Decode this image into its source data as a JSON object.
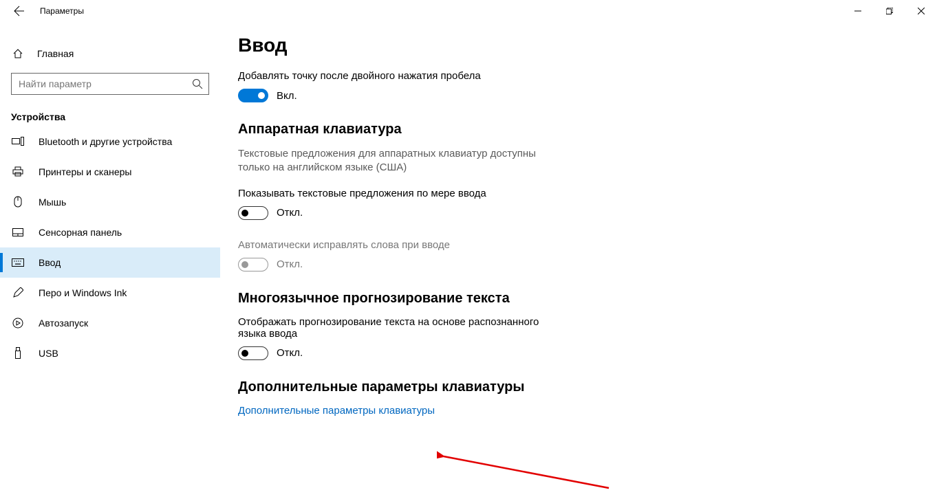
{
  "window": {
    "title": "Параметры"
  },
  "sidebar": {
    "home": "Главная",
    "search_placeholder": "Найти параметр",
    "category": "Устройства",
    "items": [
      {
        "label": "Bluetooth и другие устройства"
      },
      {
        "label": "Принтеры и сканеры"
      },
      {
        "label": "Мышь"
      },
      {
        "label": "Сенсорная панель"
      },
      {
        "label": "Ввод"
      },
      {
        "label": "Перо и Windows Ink"
      },
      {
        "label": "Автозапуск"
      },
      {
        "label": "USB"
      }
    ]
  },
  "main": {
    "title": "Ввод",
    "setting1_label": "Добавлять точку после двойного нажатия пробела",
    "setting1_state": "Вкл.",
    "section2": "Аппаратная клавиатура",
    "section2_desc": "Текстовые предложения для аппаратных клавиатур доступны только на английском языке (США)",
    "setting2_label": "Показывать текстовые предложения по мере ввода",
    "setting2_state": "Откл.",
    "setting3_label": "Автоматически исправлять слова при вводе",
    "setting3_state": "Откл.",
    "section3": "Многоязычное прогнозирование текста",
    "setting4_label": "Отображать прогнозирование текста на основе распознанного языка ввода",
    "setting4_state": "Откл.",
    "section4": "Дополнительные параметры клавиатуры",
    "link1": "Дополнительные параметры клавиатуры"
  }
}
